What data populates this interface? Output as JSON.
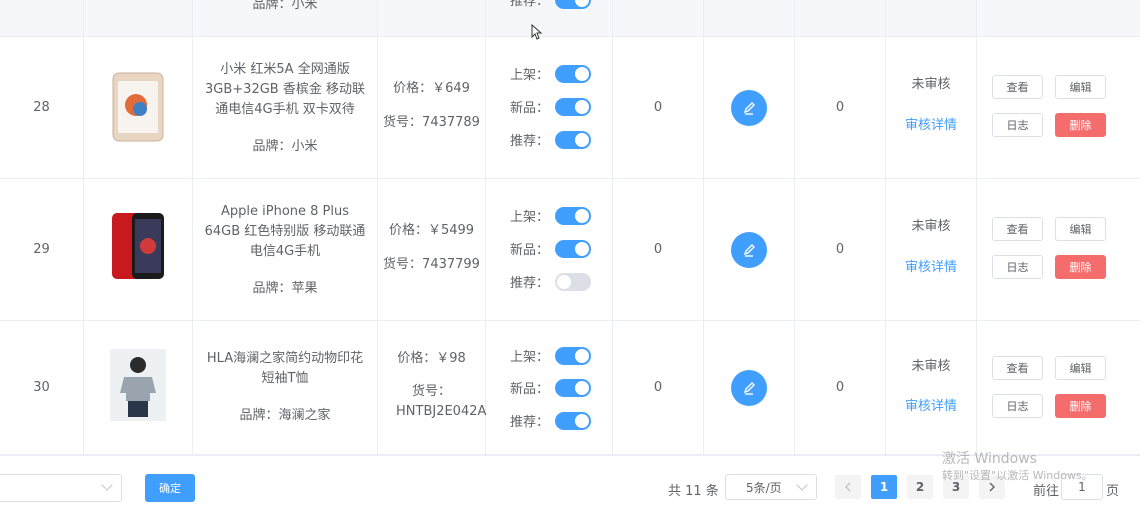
{
  "partial_row": {
    "brand": "品牌：小米",
    "switch_label": "推荐："
  },
  "rows": [
    {
      "id": "28",
      "name": "小米 红米5A 全网通版 3GB+32GB 香槟金 移动联通电信4G手机 双卡双待",
      "brand": "品牌：小米",
      "price": "价格：￥649",
      "sku": "货号：7437789",
      "on_label": "上架：",
      "new_label": "新品：",
      "rec_label": "推荐：",
      "on": true,
      "is_new": true,
      "recommend": true,
      "stock": "0",
      "sales": "0",
      "audit_status": "未审核",
      "audit_link": "审核详情",
      "btn_view": "查看",
      "btn_edit": "编辑",
      "btn_log": "日志",
      "btn_delete": "删除"
    },
    {
      "id": "29",
      "name": "Apple iPhone 8 Plus 64GB 红色特别版 移动联通电信4G手机",
      "brand": "品牌：苹果",
      "price": "价格：￥5499",
      "sku": "货号：7437799",
      "on_label": "上架：",
      "new_label": "新品：",
      "rec_label": "推荐：",
      "on": true,
      "is_new": true,
      "recommend": false,
      "stock": "0",
      "sales": "0",
      "audit_status": "未审核",
      "audit_link": "审核详情",
      "btn_view": "查看",
      "btn_edit": "编辑",
      "btn_log": "日志",
      "btn_delete": "删除"
    },
    {
      "id": "30",
      "name": "HLA海澜之家简约动物印花短袖T恤",
      "brand": "品牌：海澜之家",
      "price": "价格：￥98",
      "sku": "货号：HNTBJ2E042A",
      "on_label": "上架：",
      "new_label": "新品：",
      "rec_label": "推荐：",
      "on": true,
      "is_new": true,
      "recommend": true,
      "stock": "0",
      "sales": "0",
      "audit_status": "未审核",
      "audit_link": "审核详情",
      "btn_view": "查看",
      "btn_edit": "编辑",
      "btn_log": "日志",
      "btn_delete": "删除"
    }
  ],
  "footer": {
    "confirm": "确定",
    "total": "共 11 条",
    "page_size": "5条/页",
    "pages": [
      "1",
      "2",
      "3"
    ],
    "current_page": "1",
    "goto_label": "前往",
    "goto_value": "1",
    "goto_suffix": "页"
  },
  "watermark": {
    "line1": "激活 Windows",
    "line2": "转到\"设置\"以激活 Windows。"
  },
  "colors": {
    "primary": "#409eff",
    "danger": "#f56c6c",
    "border": "#ebeef5"
  }
}
